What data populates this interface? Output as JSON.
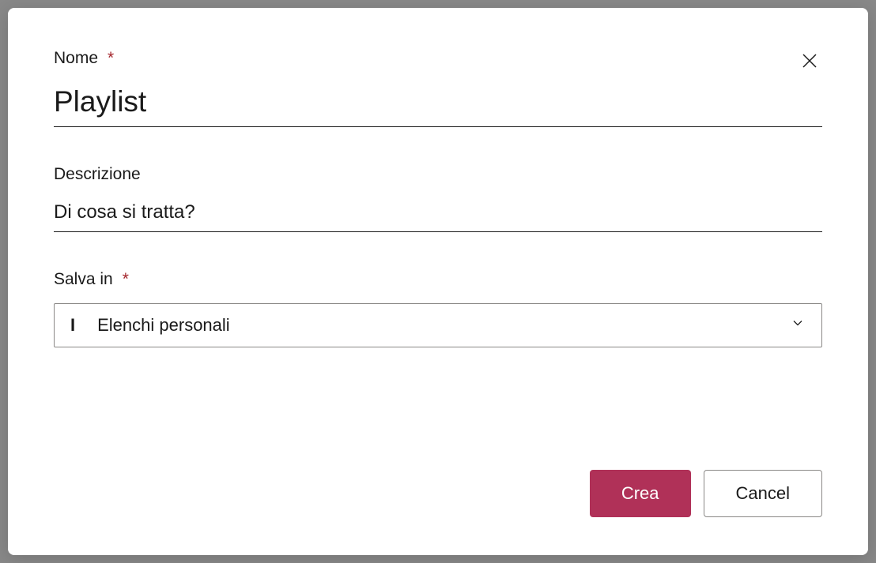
{
  "dialog": {
    "name": {
      "label": "Nome",
      "required_mark": "*",
      "value": "Playlist"
    },
    "description": {
      "label": "Descrizione",
      "placeholder": "Di cosa si tratta?"
    },
    "save_in": {
      "label": "Salva in",
      "required_mark": "*",
      "prefix": "I",
      "value": "Elenchi personali"
    },
    "buttons": {
      "create": "Crea",
      "cancel": "Cancel"
    }
  }
}
